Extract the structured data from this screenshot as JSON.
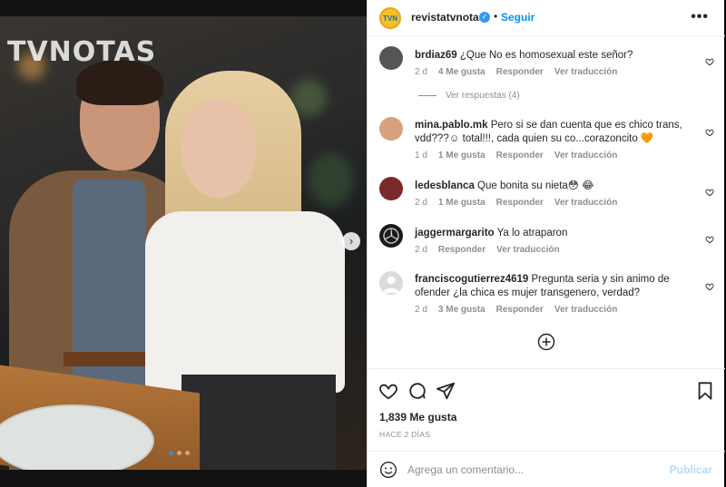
{
  "photo": {
    "watermark": "TVNOTAS",
    "next_arrow_icon": "chevron-right-icon",
    "carousel_dots": 3,
    "active_dot": 0
  },
  "header": {
    "username": "revistatvnotas",
    "avatar_text": "TVN",
    "separator": "•",
    "follow_label": "Seguir",
    "more_icon": "more-horizontal-icon",
    "more_label": "•••"
  },
  "comments": [
    {
      "username": "brdiaz69",
      "text": "¿Que No es homosexual este señor?",
      "age": "2 d",
      "likes": "4 Me gusta",
      "reply": "Responder",
      "translate": "Ver traducción",
      "avatar_color": "#555555"
    },
    {
      "username": "mina.pablo.mk",
      "text": "Pero si se dan cuenta que es chico trans, vdd???☺ total!!!, cada quien su co...corazoncito 🧡",
      "age": "1 d",
      "likes": "1 Me gusta",
      "reply": "Responder",
      "translate": "Ver traducción",
      "avatar_color": "#d8a07c"
    },
    {
      "username": "ledesblanca",
      "text": "Que bonita su nieta😳 😂",
      "age": "2 d",
      "likes": "1 Me gusta",
      "reply": "Responder",
      "translate": "Ver traducción",
      "avatar_color": "#7a2a2a"
    },
    {
      "username": "jaggermargarito",
      "text": "Ya lo atraparon",
      "age": "2 d",
      "likes": "",
      "reply": "Responder",
      "translate": "Ver traducción",
      "avatar_color": "#1a1a1a"
    },
    {
      "username": "franciscogutierrez4619",
      "text": "Pregunta seria y sin animo de ofender ¿la chica es mujer transgenero, verdad?",
      "age": "2 d",
      "likes": "3 Me gusta",
      "reply": "Responder",
      "translate": "Ver traducción",
      "avatar_color": "#dbdbdb"
    }
  ],
  "view_replies": "Ver respuestas (4)",
  "actions": {
    "like_icon": "heart-icon",
    "comment_icon": "comment-icon",
    "share_icon": "send-icon",
    "save_icon": "bookmark-icon",
    "likes_count": "1,839 Me gusta",
    "posted_ago": "HACE 2 DÍAS"
  },
  "composer": {
    "placeholder": "Agrega un comentario...",
    "publish_label": "Publicar",
    "emoji_icon": "emoji-icon"
  },
  "colors": {
    "accent": "#0095f6",
    "publish_disabled": "#b3dbff",
    "secondary_text": "#8e8e8e",
    "verified": "#3897f0"
  }
}
